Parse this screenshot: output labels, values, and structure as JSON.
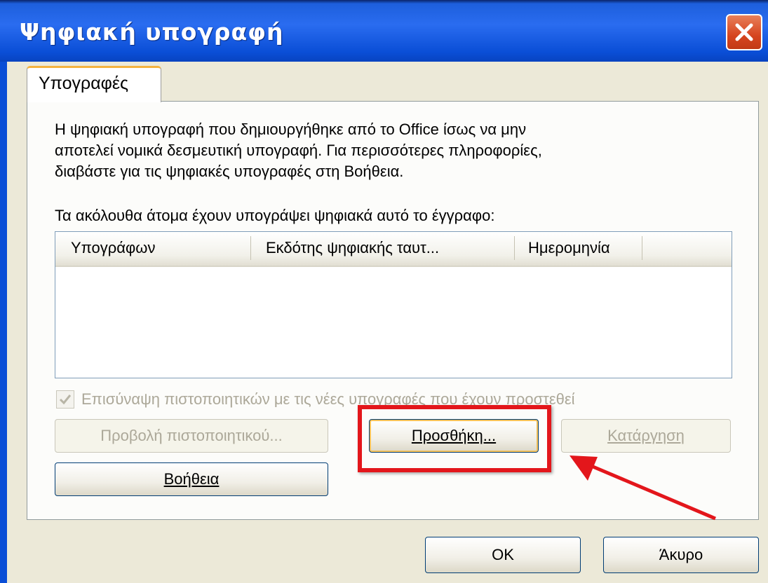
{
  "window": {
    "title": "Ψηφιακή υπογραφή"
  },
  "tabs": [
    {
      "label": "Υπογραφές",
      "active": true
    }
  ],
  "info": {
    "line1": "Η ψηφιακή υπογραφή που δημιουργήθηκε από το Office ίσως να μην",
    "line2": "αποτελεί νομικά δεσμευτική υπογραφή. Για περισσότερες πληροφορίες,",
    "line3": "διαβάστε για τις ψηφιακές υπογραφές στη Βοήθεια."
  },
  "list_label": "Τα ακόλουθα άτομα έχουν υπογράψει ψηφιακά αυτό το έγγραφο:",
  "signatures_table": {
    "columns": [
      "Υπογράφων",
      "Εκδότης ψηφιακής ταυτ...",
      "Ημερομηνία"
    ],
    "rows": []
  },
  "attach_checkbox": {
    "label": "Επισύναψη πιστοποιητικών με τις νέες υπογραφές που έχουν προστεθεί",
    "checked": true,
    "enabled": false
  },
  "buttons": {
    "view_certificate": "Προβολή πιστοποιητικού...",
    "add": "Προσθήκη...",
    "remove": "Κατάργηση",
    "help": "Βοήθεια",
    "ok": "OK",
    "cancel": "Άκυρο"
  },
  "colors": {
    "titlebar": "#0a4ed6",
    "dialog_bg": "#ece9d8",
    "annotation": "#e3161b"
  },
  "icons": {
    "close": "close-icon",
    "check": "checkmark-icon",
    "annotation_arrow": "arrow-icon"
  }
}
